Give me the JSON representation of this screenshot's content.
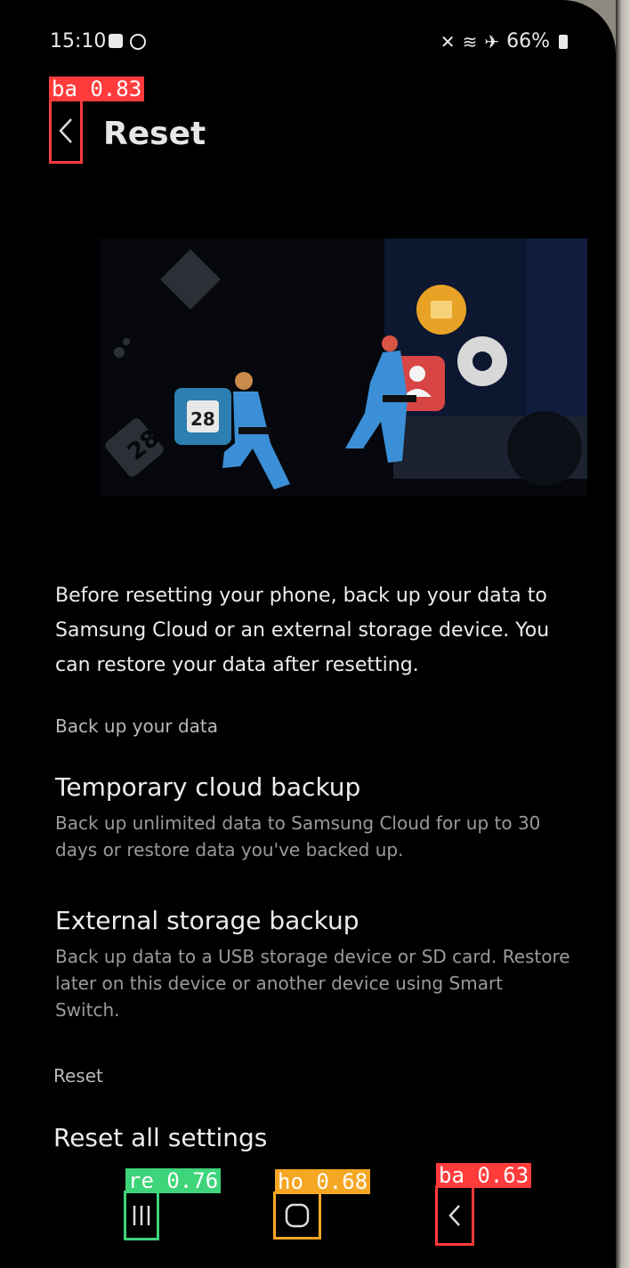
{
  "status_bar": {
    "time": "15:10",
    "battery": "66%"
  },
  "header": {
    "title": "Reset"
  },
  "illustration": {
    "calendar_day": "28"
  },
  "description": "Before resetting your phone, back up your data to Samsung Cloud or an external storage device. You can restore your data after resetting.",
  "sections": {
    "backup_header": "Back up your data",
    "temporary": {
      "title": "Temporary cloud backup",
      "subtitle": "Back up unlimited data to Samsung Cloud for up to 30 days or restore data you've backed up."
    },
    "external": {
      "title": "External storage backup",
      "subtitle": "Back up data to a USB storage device or SD card. Restore later on this device or another device using Smart Switch."
    },
    "reset_header": "Reset",
    "reset_all": "Reset all settings"
  },
  "detections": {
    "back_top": "ba 0.83",
    "recents": "re 0.76",
    "home": "ho 0.68",
    "back_nav": "ba 0.63"
  },
  "colors": {
    "back_box": "#ff3b3b",
    "recents_box": "#3ed47a",
    "home_box": "#f5a623",
    "accent_blue": "#3b8fd6"
  }
}
